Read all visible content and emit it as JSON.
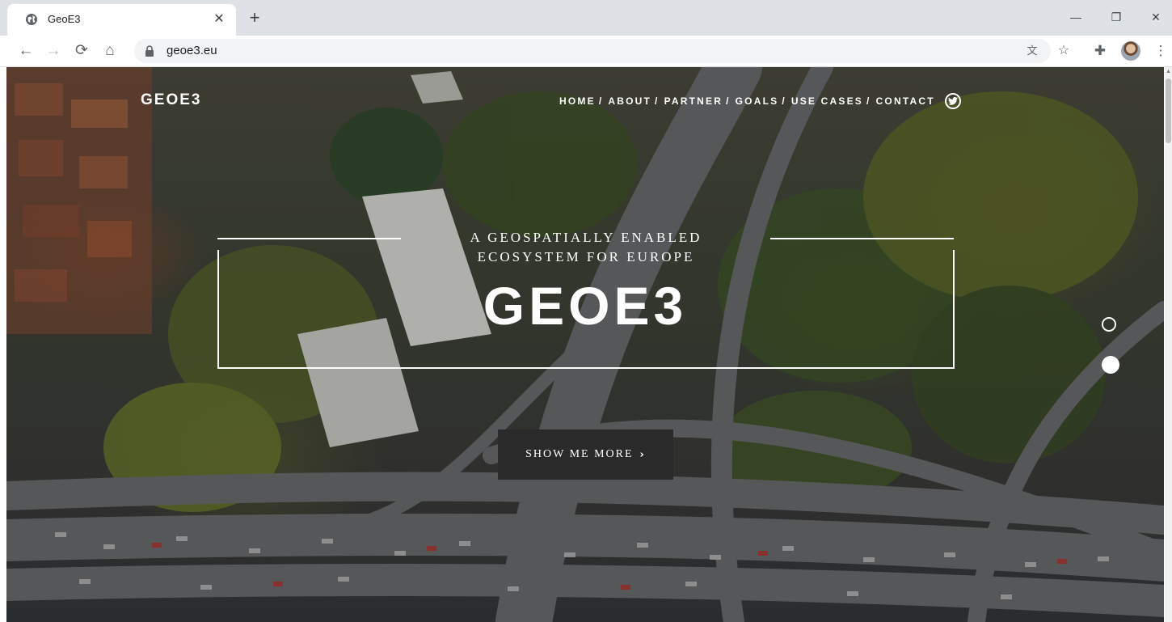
{
  "browser": {
    "tab_title": "GeoE3",
    "close_tab_icon": "close-icon",
    "new_tab_icon": "plus-icon",
    "url": "geoe3.eu",
    "icons": [
      "back-arrow-icon",
      "forward-arrow-icon",
      "reload-icon",
      "home-icon",
      "lock-icon",
      "translate-icon",
      "star-icon",
      "extensions-icon",
      "avatar",
      "more-vert-icon",
      "minimize-icon",
      "restore-icon",
      "close-window-icon"
    ]
  },
  "site": {
    "brand": "GEOE3",
    "nav": [
      {
        "label": "HOME"
      },
      {
        "label": "ABOUT"
      },
      {
        "label": "PARTNER"
      },
      {
        "label": "GOALS"
      },
      {
        "label": "USE CASES"
      },
      {
        "label": "CONTACT"
      }
    ],
    "nav_separator": "/",
    "social_icon": "twitter-icon"
  },
  "hero": {
    "tagline_line1": "A GEOSPATIALLY ENABLED",
    "tagline_line2": "ECOSYSTEM FOR EUROPE",
    "title": "GEOE3",
    "cta_label": "SHOW ME MORE",
    "cta_icon": "chevron-right-icon",
    "slides": 2,
    "active_slide": 2
  },
  "colors": {
    "chrome_tabstrip": "#dee1e6",
    "omnibox": "#f1f3f4",
    "cta_background": "#2a2a2a",
    "hero_text": "#ffffff"
  }
}
